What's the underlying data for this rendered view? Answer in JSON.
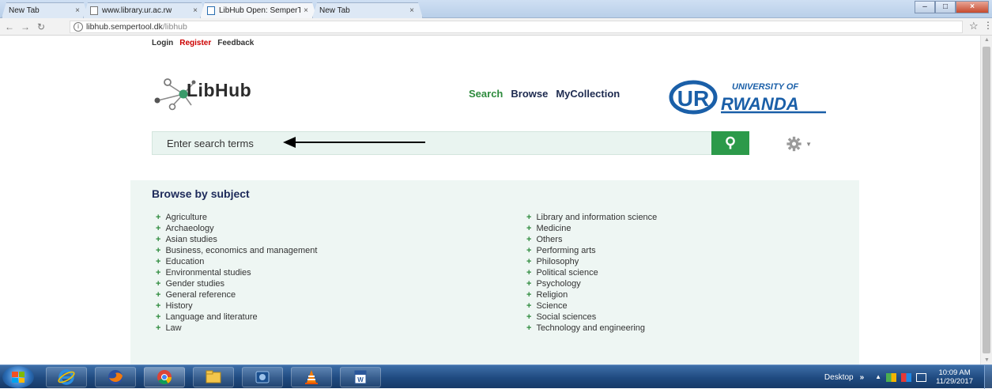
{
  "browser": {
    "tabs": [
      {
        "title": "New Tab",
        "active": false
      },
      {
        "title": "www.library.ur.ac.rw",
        "active": false
      },
      {
        "title": "LibHub Open: SemperTo",
        "active": true
      },
      {
        "title": "New Tab",
        "active": false
      }
    ],
    "tab_close": "×",
    "url_host": "libhub.sempertool.dk",
    "url_path": "/libhub"
  },
  "page": {
    "top_links": {
      "login": "Login",
      "register": "Register",
      "feedback": "Feedback"
    },
    "logo_text": "LibHub",
    "main_nav": {
      "search": "Search",
      "browse": "Browse",
      "collection": "MyCollection"
    },
    "university": {
      "line1": "UNIVERSITY OF",
      "line2": "RWANDA",
      "mark": "UR"
    },
    "search": {
      "placeholder": "Enter search terms"
    },
    "browse": {
      "title": "Browse by subject",
      "plus": "+",
      "left": [
        "Agriculture",
        "Archaeology",
        "Asian studies",
        "Business, economics and management",
        "Education",
        "Environmental studies",
        "Gender studies",
        "General reference",
        "History",
        "Language and literature",
        "Law"
      ],
      "right": [
        "Library and information science",
        "Medicine",
        "Others",
        "Performing arts",
        "Philosophy",
        "Political science",
        "Psychology",
        "Religion",
        "Science",
        "Social sciences",
        "Technology and engineering"
      ]
    }
  },
  "taskbar": {
    "desktop_label": "Desktop",
    "chevron": "»",
    "time": "10:09 AM",
    "date": "11/29/2017"
  },
  "colors": {
    "accent_green": "#2c9a4a",
    "nav_dark": "#1d2a4f",
    "register_red": "#cc0000",
    "panel_bg": "#eef6f3",
    "uni_blue": "#1a5fa8"
  }
}
